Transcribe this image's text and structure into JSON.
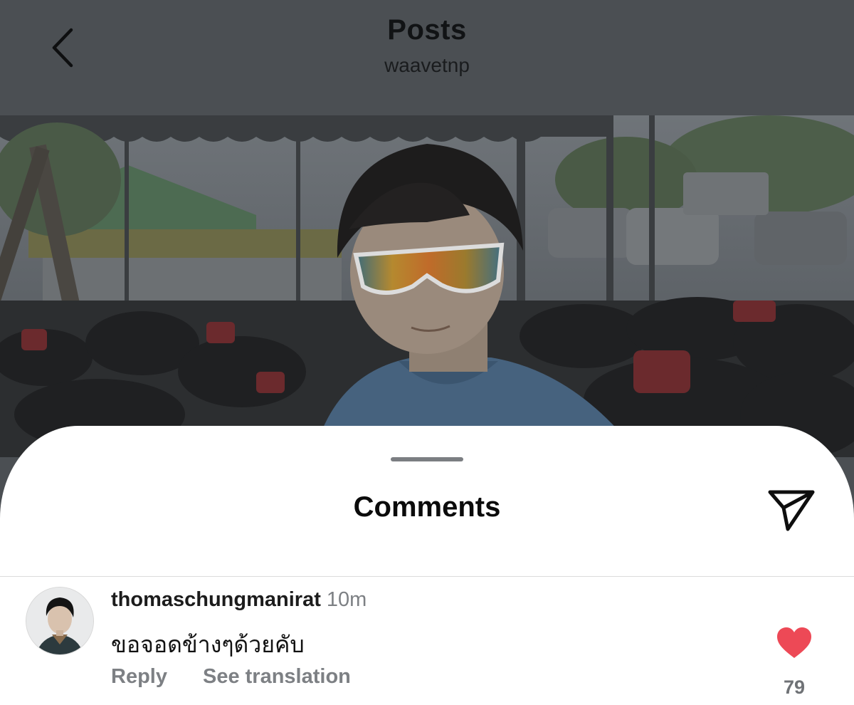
{
  "header": {
    "title": "Posts",
    "username": "waavetnp",
    "back_icon": "chevron-left-icon"
  },
  "post": {
    "image": "photo-of-person-wearing-sport-sunglasses-with-atvs",
    "overlay_dimmed": true
  },
  "comments_sheet": {
    "title": "Comments",
    "share_icon": "paper-plane-icon",
    "items": [
      {
        "username": "thomaschungmanirat",
        "time": "10m",
        "text": "ขอจอดข้างๆด้วยคับ",
        "reply_label": "Reply",
        "translate_label": "See translation",
        "like_icon": "heart-filled-icon",
        "like_color": "#ed4956",
        "like_count": "79"
      }
    ]
  }
}
